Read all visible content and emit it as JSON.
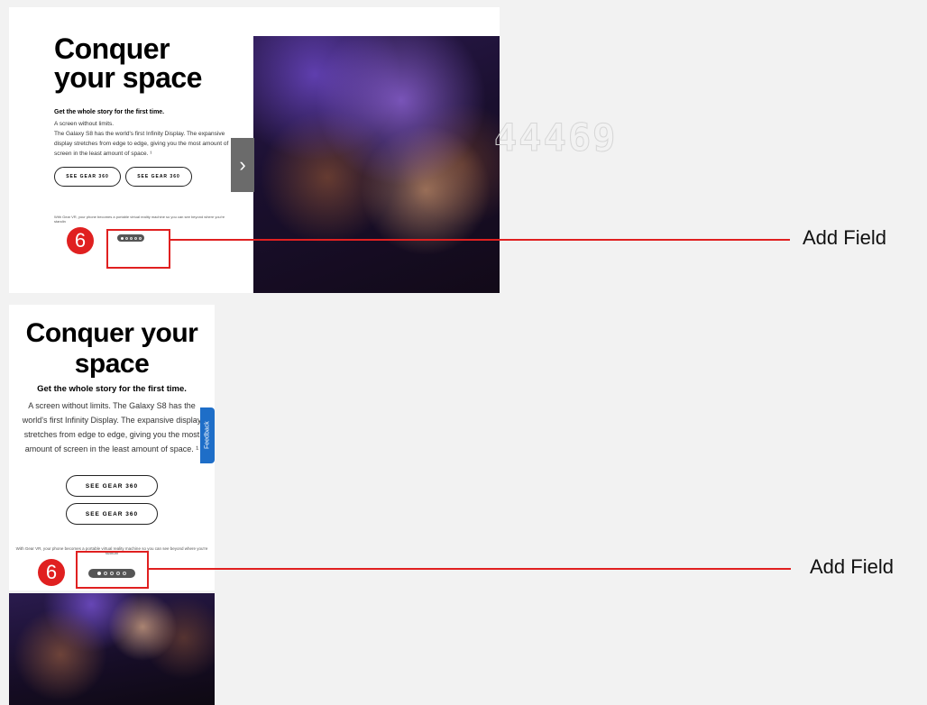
{
  "desktop": {
    "title": "Conquer\nyour space",
    "subhead": "Get the whole story for the first time.",
    "body_lines": [
      "A screen without limits.",
      "The Galaxy S8 has the world's first Infinity Display. The expansive display stretches from edge to edge, giving you the most amount of screen in the least amount of space. ¹"
    ],
    "button_1": "SEE GEAR 360",
    "button_2": "SEE GEAR 360",
    "fine_print": "With Gear VR, your phone becomes a portable virtual reality machine so you can see beyond where you're standin",
    "next_arrow": "›",
    "watermark": "44469"
  },
  "mobile": {
    "title": "Conquer your space",
    "subhead": "Get the whole story for the first time.",
    "body": "A screen without limits. The Galaxy S8 has the world's first Infinity Display. The expansive display stretches from edge to edge, giving you the most amount of screen in the least amount of space. ¹",
    "button_1": "SEE GEAR 360",
    "button_2": "SEE GEAR 360",
    "fine_print": "With Gear VR, your phone becomes a portable virtual reality machine so you can see beyond where you're standin",
    "feedback_label": "Feedback"
  },
  "carousel": {
    "slide_count": 5,
    "active_slide": 1
  },
  "annotations": [
    {
      "marker": "6",
      "label": "Add Field"
    },
    {
      "marker": "6",
      "label": "Add Field"
    }
  ],
  "colors": {
    "annotation_red": "#e02020",
    "feedback_blue": "#1e6ec8",
    "dots_bar": "#555555"
  }
}
